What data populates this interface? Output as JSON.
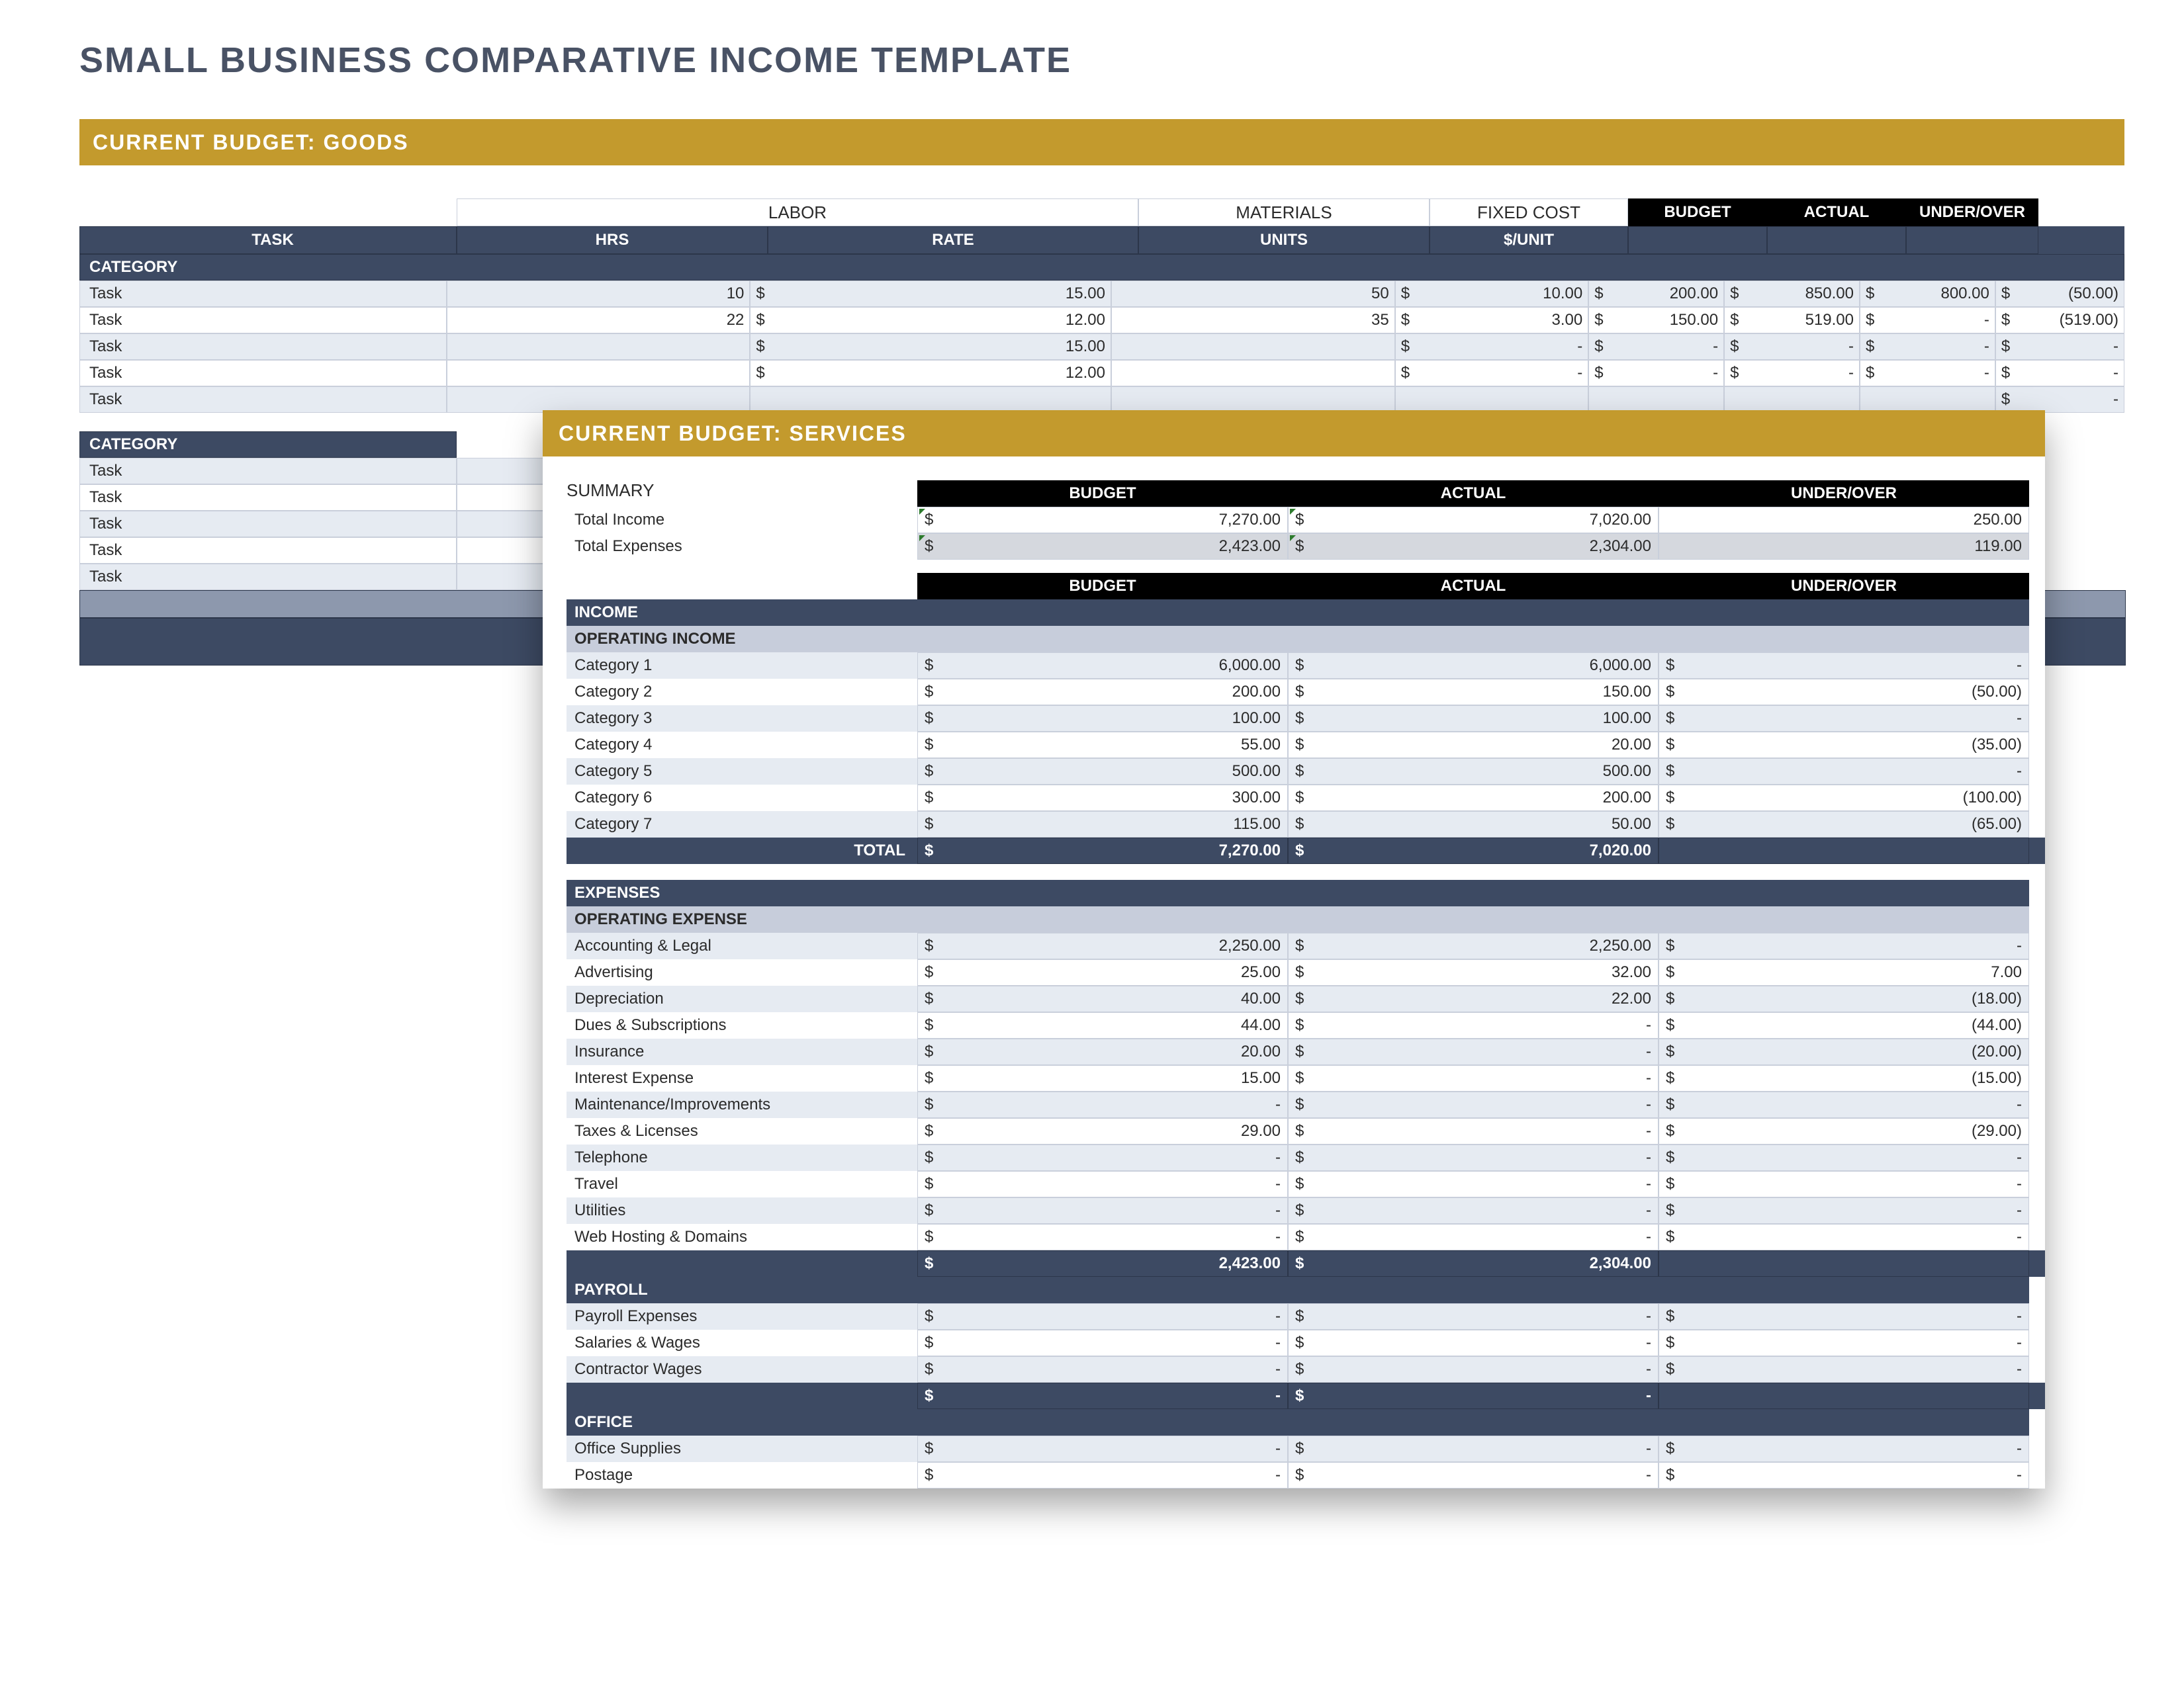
{
  "title": "SMALL BUSINESS COMPARATIVE INCOME TEMPLATE",
  "goods": {
    "heading": "CURRENT BUDGET: GOODS",
    "group_labor": "LABOR",
    "group_materials": "MATERIALS",
    "group_fixed": "FIXED COST",
    "head_budget": "BUDGET",
    "head_actual": "ACTUAL",
    "head_uo": "UNDER/OVER",
    "sub_task": "TASK",
    "sub_hrs": "HRS",
    "sub_rate": "RATE",
    "sub_units": "UNITS",
    "sub_per": "$/UNIT",
    "cat_label": "CATEGORY",
    "rows1": [
      {
        "task": "Task",
        "hrs": "10",
        "rate": "15.00",
        "units": "50",
        "per": "10.00",
        "fixed": "200.00",
        "budget": "850.00",
        "actual": "800.00",
        "uo": "(50.00)"
      },
      {
        "task": "Task",
        "hrs": "22",
        "rate": "12.00",
        "units": "35",
        "per": "3.00",
        "fixed": "150.00",
        "budget": "519.00",
        "actual": "-",
        "uo": "(519.00)"
      },
      {
        "task": "Task",
        "hrs": "",
        "rate": "15.00",
        "units": "",
        "per": "-",
        "fixed": "-",
        "budget": "-",
        "actual": "-",
        "uo": "-"
      },
      {
        "task": "Task",
        "hrs": "",
        "rate": "12.00",
        "units": "",
        "per": "-",
        "fixed": "-",
        "budget": "-",
        "actual": "-",
        "uo": "-"
      },
      {
        "task": "Task",
        "hrs": "",
        "rate": "",
        "units": "",
        "per": "",
        "fixed": "",
        "budget": "",
        "actual": "",
        "uo": "-"
      }
    ],
    "rows2": [
      {
        "task": "Task",
        "uo": "-"
      },
      {
        "task": "Task",
        "uo": "-"
      },
      {
        "task": "Task",
        "uo": "-"
      },
      {
        "task": "Task",
        "uo": "-"
      },
      {
        "task": "Task",
        "uo": "-"
      }
    ]
  },
  "services": {
    "heading": "CURRENT BUDGET: SERVICES",
    "summary_label": "SUMMARY",
    "head_budget": "BUDGET",
    "head_actual": "ACTUAL",
    "head_uo": "UNDER/OVER",
    "total_income_label": "Total Income",
    "total_income": {
      "budget": "7,270.00",
      "actual": "7,020.00",
      "uo": "250.00"
    },
    "total_expenses_label": "Total Expenses",
    "total_expenses": {
      "budget": "2,423.00",
      "actual": "2,304.00",
      "uo": "119.00"
    },
    "income_head": "INCOME",
    "income_sub": "OPERATING INCOME",
    "income_rows": [
      {
        "label": "Category 1",
        "budget": "6,000.00",
        "actual": "6,000.00",
        "uo": "-"
      },
      {
        "label": "Category 2",
        "budget": "200.00",
        "actual": "150.00",
        "uo": "(50.00)"
      },
      {
        "label": "Category 3",
        "budget": "100.00",
        "actual": "100.00",
        "uo": "-"
      },
      {
        "label": "Category 4",
        "budget": "55.00",
        "actual": "20.00",
        "uo": "(35.00)"
      },
      {
        "label": "Category 5",
        "budget": "500.00",
        "actual": "500.00",
        "uo": "-"
      },
      {
        "label": "Category 6",
        "budget": "300.00",
        "actual": "200.00",
        "uo": "(100.00)"
      },
      {
        "label": "Category 7",
        "budget": "115.00",
        "actual": "50.00",
        "uo": "(65.00)"
      }
    ],
    "income_total_label": "TOTAL",
    "income_total": {
      "budget": "7,270.00",
      "actual": "7,020.00"
    },
    "expenses_head": "EXPENSES",
    "expenses_sub": "OPERATING EXPENSE",
    "expense_rows": [
      {
        "label": "Accounting & Legal",
        "budget": "2,250.00",
        "actual": "2,250.00",
        "uo": "-"
      },
      {
        "label": "Advertising",
        "budget": "25.00",
        "actual": "32.00",
        "uo": "7.00"
      },
      {
        "label": "Depreciation",
        "budget": "40.00",
        "actual": "22.00",
        "uo": "(18.00)"
      },
      {
        "label": "Dues & Subscriptions",
        "budget": "44.00",
        "actual": "-",
        "uo": "(44.00)"
      },
      {
        "label": "Insurance",
        "budget": "20.00",
        "actual": "-",
        "uo": "(20.00)"
      },
      {
        "label": "Interest Expense",
        "budget": "15.00",
        "actual": "-",
        "uo": "(15.00)"
      },
      {
        "label": "Maintenance/Improvements",
        "budget": "-",
        "actual": "-",
        "uo": "-"
      },
      {
        "label": "Taxes & Licenses",
        "budget": "29.00",
        "actual": "-",
        "uo": "(29.00)"
      },
      {
        "label": "Telephone",
        "budget": "-",
        "actual": "-",
        "uo": "-"
      },
      {
        "label": "Travel",
        "budget": "-",
        "actual": "-",
        "uo": "-"
      },
      {
        "label": "Utilities",
        "budget": "-",
        "actual": "-",
        "uo": "-"
      },
      {
        "label": "Web Hosting & Domains",
        "budget": "-",
        "actual": "-",
        "uo": "-"
      }
    ],
    "expense_total": {
      "budget": "2,423.00",
      "actual": "2,304.00"
    },
    "payroll_head": "PAYROLL",
    "payroll_rows": [
      {
        "label": "Payroll Expenses",
        "budget": "-",
        "actual": "-",
        "uo": "-"
      },
      {
        "label": "Salaries & Wages",
        "budget": "-",
        "actual": "-",
        "uo": "-"
      },
      {
        "label": "Contractor Wages",
        "budget": "-",
        "actual": "-",
        "uo": "-"
      }
    ],
    "payroll_total": {
      "budget": "-",
      "actual": "-"
    },
    "office_head": "OFFICE",
    "office_rows": [
      {
        "label": "Office Supplies",
        "budget": "-",
        "actual": "-",
        "uo": "-"
      },
      {
        "label": "Postage",
        "budget": "-",
        "actual": "-",
        "uo": "-"
      }
    ]
  }
}
